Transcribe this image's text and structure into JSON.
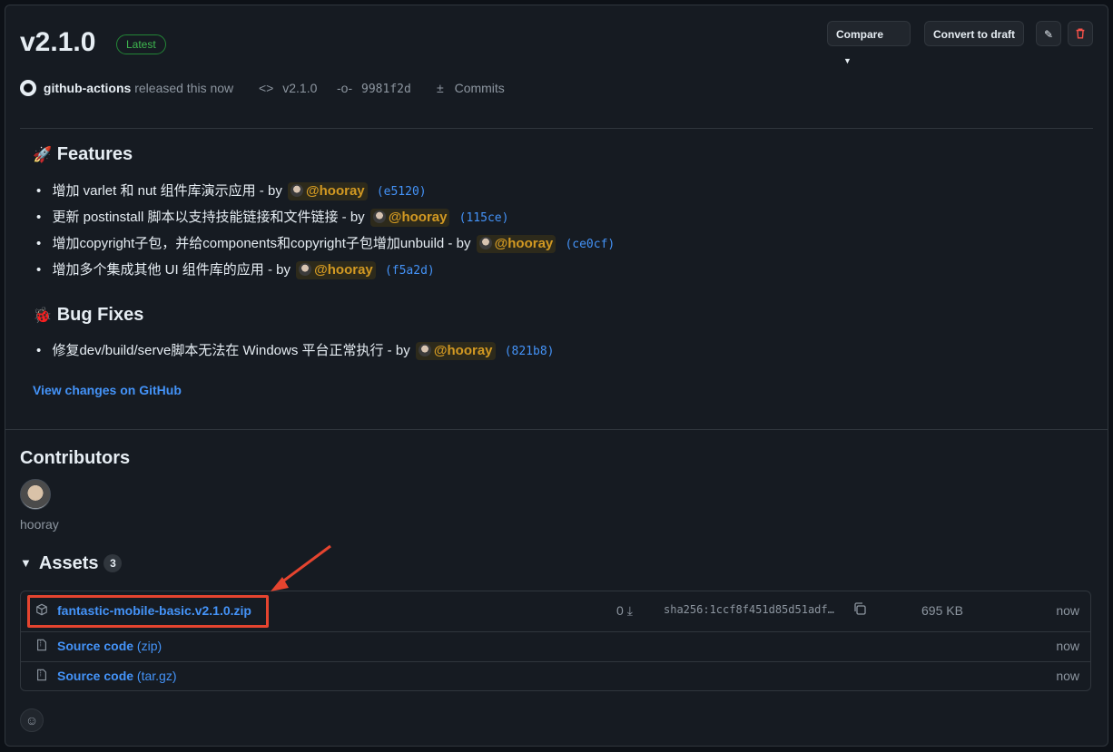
{
  "release": {
    "title": "v2.1.0",
    "badge": "Latest",
    "author": "github-actions",
    "released_text": "released this now",
    "tag": "v2.1.0",
    "commit": "9981f2d",
    "commits_label": "Commits"
  },
  "toolbar": {
    "compare_label": "Compare",
    "convert_label": "Convert to draft"
  },
  "features": {
    "heading_emoji": "🚀",
    "heading": "Features",
    "items": [
      {
        "text": "增加 varlet 和 nut 组件库演示应用",
        "by": "by",
        "user": "@hooray",
        "sha": "(e5120)"
      },
      {
        "text": "更新 postinstall 脚本以支持技能链接和文件链接",
        "by": "by",
        "user": "@hooray",
        "sha": "(115ce)"
      },
      {
        "text": "增加copyright子包，并给components和copyright子包增加unbuild",
        "by": "by",
        "user": "@hooray",
        "sha": "(ce0cf)"
      },
      {
        "text": "增加多个集成其他 UI 组件库的应用",
        "by": "by",
        "user": "@hooray",
        "sha": "(f5a2d)"
      }
    ]
  },
  "bugfixes": {
    "heading_emoji": "🐞",
    "heading": "Bug Fixes",
    "items": [
      {
        "text": "修复dev/build/serve脚本无法在 Windows 平台正常执行",
        "by": "by",
        "user": "@hooray",
        "sha": "(821b8)"
      }
    ]
  },
  "view_changes": "View changes on GitHub",
  "contributors": {
    "heading": "Contributors",
    "name": "hooray"
  },
  "assets": {
    "heading": "Assets",
    "count": "3",
    "items": [
      {
        "name": "fantastic-mobile-basic.v2.1.0.zip",
        "downloads": "0",
        "sha256": "sha256:1ccf8f451d85d51adf…",
        "size": "695 KB",
        "time": "now"
      },
      {
        "name": "Source code",
        "suffix": "(zip)",
        "time": "now"
      },
      {
        "name": "Source code",
        "suffix": "(tar.gz)",
        "time": "now"
      }
    ]
  }
}
